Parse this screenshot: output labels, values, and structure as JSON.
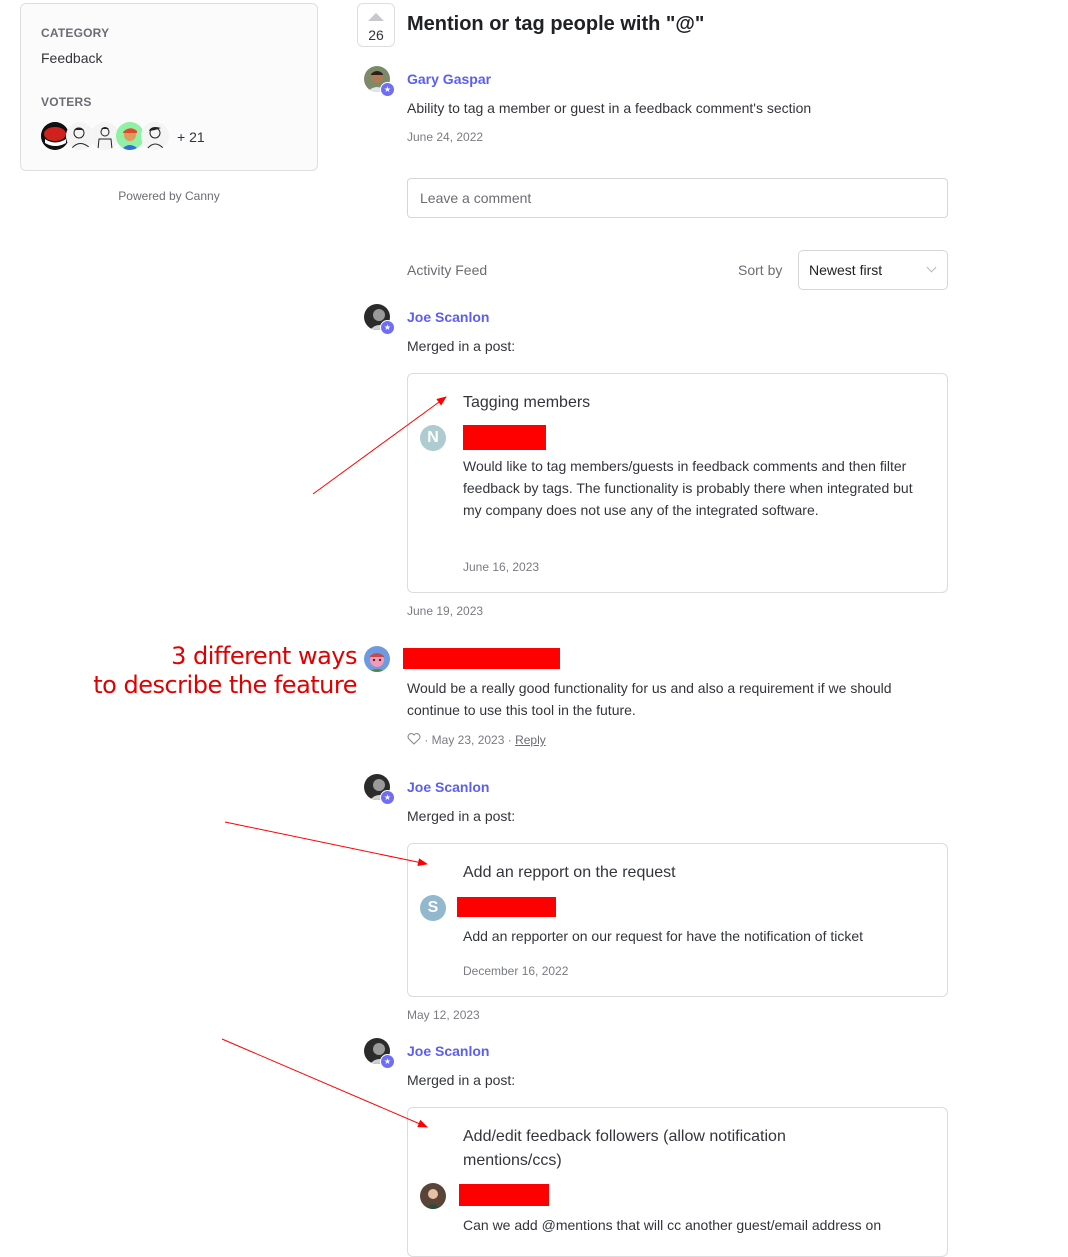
{
  "sidebar": {
    "category_label": "CATEGORY",
    "category_value": "Feedback",
    "voters_label": "VOTERS",
    "voters_more": "+ 21",
    "voters": [
      {
        "name": "voter-avatar-redhat",
        "bg": "#c8231f"
      },
      {
        "name": "voter-avatar-sketch-1",
        "bg": "#f4f4f4"
      },
      {
        "name": "voter-avatar-sketch-2",
        "bg": "#f4f4f4"
      },
      {
        "name": "voter-avatar-cap",
        "bg": "#8ff0a6"
      },
      {
        "name": "voter-avatar-sketch-3",
        "bg": "#f4f4f4"
      }
    ],
    "powered_by": "Powered by Canny"
  },
  "post": {
    "vote_count": "26",
    "title": "Mention or tag people with \"@\"",
    "author": "Gary Gaspar",
    "description": "Ability to tag a member or guest in a feedback comment's section",
    "date": "June 24, 2022"
  },
  "comment_input": {
    "placeholder": "Leave a comment"
  },
  "activity": {
    "label": "Activity Feed",
    "sort_label": "Sort by",
    "sort_value": "Newest first",
    "items": [
      {
        "author": "Joe Scanlon",
        "action": "Merged in a post:",
        "merged_title": "Tagging members",
        "merged_avatar_letter": "N",
        "merged_avatar_color": "#aecbd0",
        "merged_body": "Would like to tag members/guests in feedback comments and then filter feedback by tags. The functionality is probably there when integrated but my company does not use any of the integrated software.",
        "merged_date": "June 16, 2023",
        "date": "June 19, 2023"
      },
      {
        "type": "comment",
        "body": "Would be a really good functionality for us and also a requirement if we should continue to use this tool in the future.",
        "date": "· May 23, 2023 ·",
        "reply_label": "Reply"
      },
      {
        "author": "Joe Scanlon",
        "action": "Merged in a post:",
        "merged_title": "Add an repport on the request",
        "merged_avatar_letter": "S",
        "merged_avatar_color": "#93b7cc",
        "merged_body": "Add an repporter on our request for have the notification of ticket",
        "merged_date": "December 16, 2022",
        "date": "May 12, 2023"
      },
      {
        "author": "Joe Scanlon",
        "action": "Merged in a post:",
        "merged_title": "Add/edit feedback followers (allow notification mentions/ccs)",
        "merged_body": "Can we add @mentions that will cc another guest/email address on"
      }
    ]
  },
  "annotation": {
    "line1": "3 different ways",
    "line2": "to describe the feature",
    "color": "#e00000"
  },
  "colors": {
    "accent": "#5b5ef0",
    "redaction": "#ff0000"
  }
}
